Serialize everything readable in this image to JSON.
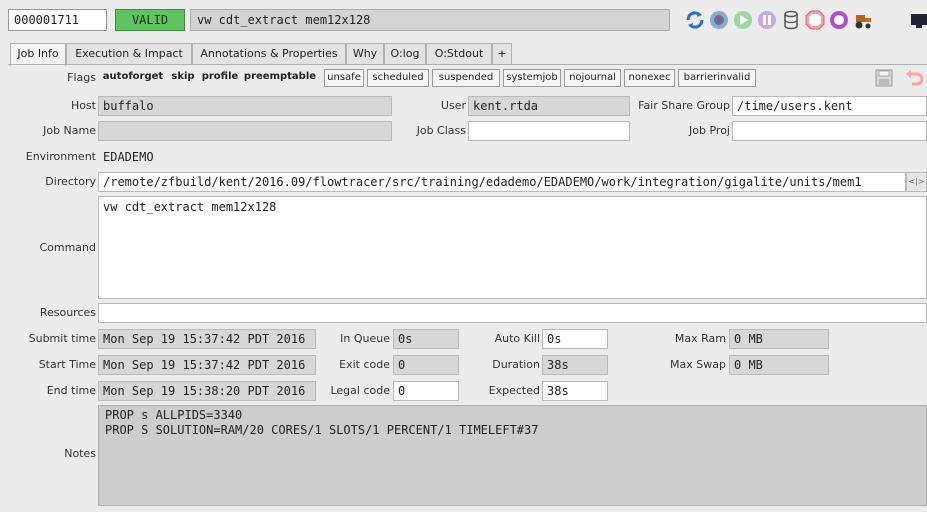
{
  "header": {
    "job_id": "000001711",
    "status": "VALID",
    "command": "vw cdt_extract mem12x128",
    "icons": [
      "refresh-icon",
      "target-icon",
      "play-icon",
      "pause-icon",
      "database-icon",
      "stop-icon",
      "stop-circle-icon",
      "tractor-icon",
      "monitor-icon"
    ]
  },
  "tabs": [
    {
      "label": "Job Info",
      "active": true
    },
    {
      "label": "Execution & Impact"
    },
    {
      "label": "Annotations & Properties"
    },
    {
      "label": "Why"
    },
    {
      "label": "O:log"
    },
    {
      "label": "O:Stdout"
    },
    {
      "label": "+"
    }
  ],
  "flags": {
    "label": "Flags",
    "bold": [
      "autoforget",
      "skip",
      "profile",
      "preemptable"
    ],
    "boxed": [
      "unsafe",
      "scheduled",
      "suspended",
      "systemjob",
      "nojournal",
      "nonexec",
      "barrierinvalid"
    ]
  },
  "fields": {
    "host_label": "Host",
    "host": "buffalo",
    "user_label": "User",
    "user": "kent.rtda",
    "fsg_label": "Fair Share Group",
    "fsg": "/time/users.kent",
    "jobname_label": "Job Name",
    "jobname": "",
    "jobclass_label": "Job Class",
    "jobclass": "",
    "jobproj_label": "Job Proj",
    "jobproj": "",
    "env_label": "Environment",
    "env": "EDADEMO",
    "dir_label": "Directory",
    "dir": "/remote/zfbuild/kent/2016.09/flowtracer/src/training/edademo/EDADEMO/work/integration/gigalite/units/mem1",
    "command_label": "Command",
    "command": "vw cdt_extract mem12x128",
    "resources_label": "Resources",
    "resources": "",
    "submit_label": "Submit time",
    "submit": "Mon Sep 19 15:37:42 PDT 2016",
    "start_label": "Start Time",
    "start": "Mon Sep 19 15:37:42 PDT 2016",
    "end_label": "End time",
    "end": "Mon Sep 19 15:38:20 PDT 2016",
    "inqueue_label": "In Queue",
    "inqueue": "0s",
    "exitcode_label": "Exit code",
    "exitcode": "0",
    "legalcode_label": "Legal code",
    "legalcode": "0",
    "autokill_label": "Auto Kill",
    "autokill": "0s",
    "duration_label": "Duration",
    "duration": "38s",
    "expected_label": "Expected",
    "expected": "38s",
    "maxram_label": "Max Ram",
    "maxram": "0 MB",
    "maxswap_label": "Max Swap",
    "maxswap": "0 MB",
    "notes_label": "Notes",
    "notes": [
      "PROP s ALLPIDS=3340",
      "PROP S SOLUTION=RAM/20 CORES/1 SLOTS/1 PERCENT/1 TIMELEFT#37"
    ]
  }
}
